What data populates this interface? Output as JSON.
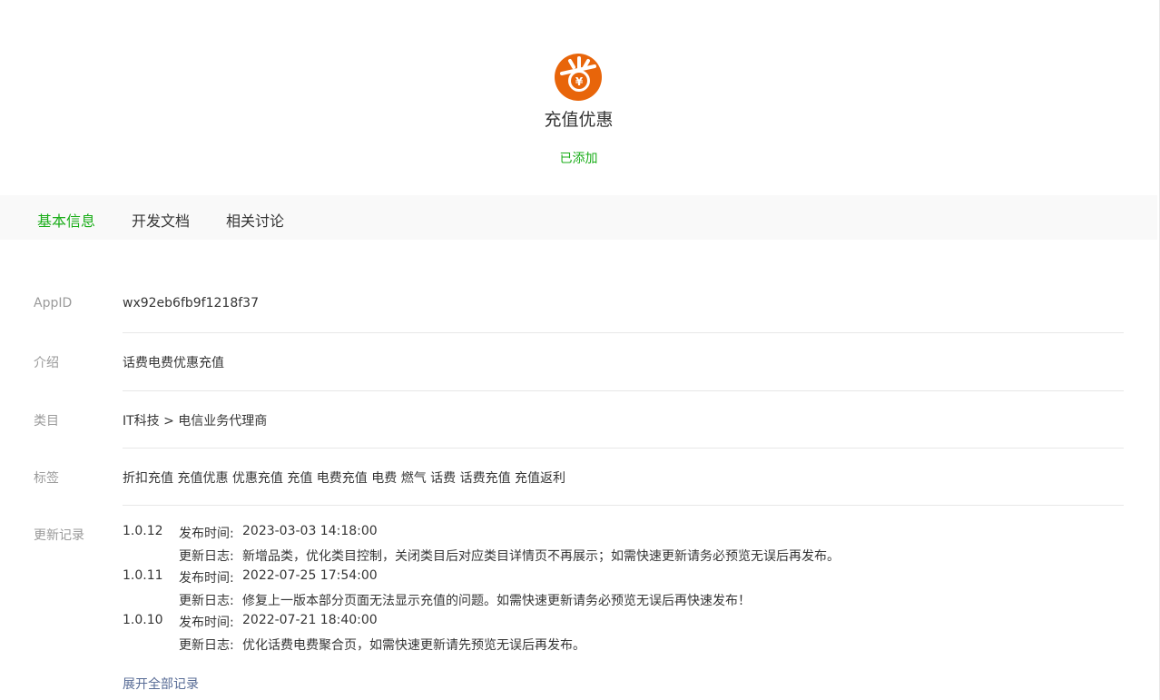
{
  "app": {
    "name": "充值优惠",
    "status": "已添加",
    "logo_char": "省",
    "logo_sub": "¥",
    "brand_color": "#e8650a",
    "accent_color": "#1aad19"
  },
  "tabs": [
    "基本信息",
    "开发文档",
    "相关讨论"
  ],
  "info": {
    "appid_label": "AppID",
    "appid": "wx92eb6fb9f1218f37",
    "intro_label": "介绍",
    "intro": "话费电费优惠充值",
    "category_label": "类目",
    "category": "IT科技 > 电信业务代理商",
    "tags_label": "标签",
    "tags": "折扣充值 充值优惠 优惠充值 充值 电费充值 电费 燃气 话费 话费充值 充值返利",
    "updates_label": "更新记录"
  },
  "updates": [
    {
      "version": "1.0.12",
      "time_label": "发布时间:",
      "time": "2023-03-03 14:18:00",
      "log_label": "更新日志:",
      "log": "新增品类，优化类目控制，关闭类目后对应类目详情页不再展示；如需快速更新请务必预览无误后再发布。"
    },
    {
      "version": "1.0.11",
      "time_label": "发布时间:",
      "time": "2022-07-25 17:54:00",
      "log_label": "更新日志:",
      "log": "修复上一版本部分页面无法显示充值的问题。如需快速更新请务必预览无误后再快速发布！"
    },
    {
      "version": "1.0.10",
      "time_label": "发布时间:",
      "time": "2022-07-21 18:40:00",
      "log_label": "更新日志:",
      "log": "优化话费电费聚合页，如需快速更新请先预览无误后再发布。"
    }
  ],
  "expand_label": "展开全部记录"
}
